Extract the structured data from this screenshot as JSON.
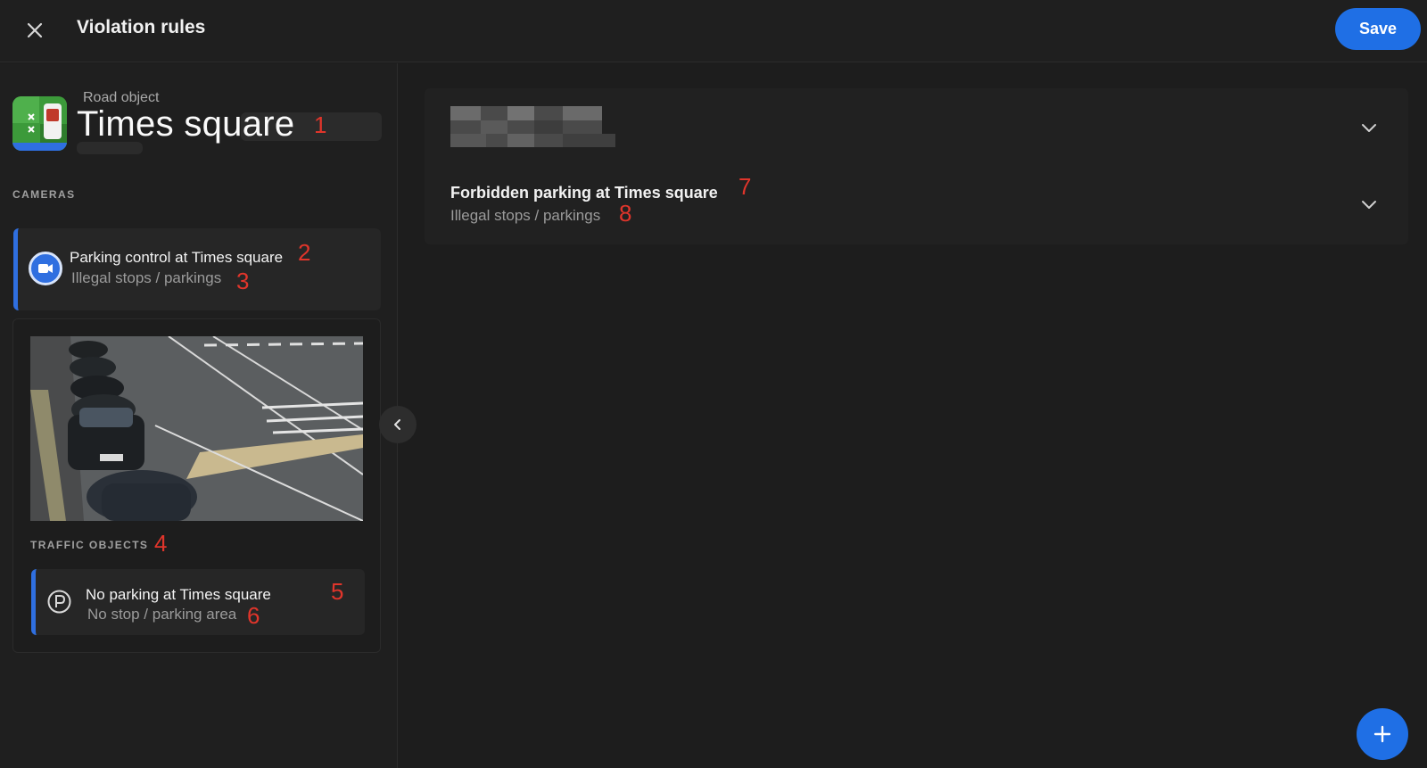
{
  "header": {
    "title": "Violation rules",
    "save_label": "Save",
    "close_icon": "close-icon"
  },
  "road_object": {
    "label": "Road object",
    "title": "Times square",
    "logo_icon": "road-object-logo"
  },
  "cameras": {
    "section_label": "CAMERAS",
    "items": [
      {
        "title": "Parking control at Times square",
        "subtitle": "Illegal stops / parkings",
        "icon": "camera-icon"
      }
    ]
  },
  "traffic_objects": {
    "section_label": "TRAFFIC OBJECTS",
    "items": [
      {
        "title": "No parking at Times square",
        "subtitle": "No stop / parking area",
        "icon": "parking-icon"
      }
    ]
  },
  "rules": [
    {
      "title": "",
      "subtitle": "",
      "blurred": true
    },
    {
      "title": "Forbidden parking at Times square",
      "subtitle": "Illegal stops / parkings"
    }
  ],
  "annotations": [
    "1",
    "2",
    "3",
    "4",
    "5",
    "6",
    "7",
    "8"
  ],
  "colors": {
    "accent": "#1f6fe5",
    "annotation": "#e0352b",
    "background": "#1d1d1d"
  }
}
